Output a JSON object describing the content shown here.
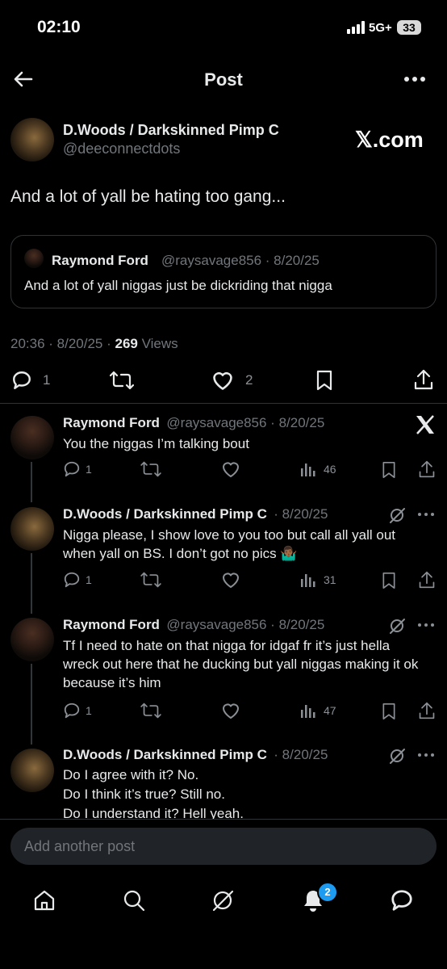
{
  "status_bar": {
    "time": "02:10",
    "network": "5G+",
    "battery": "33"
  },
  "header": {
    "title": "Post"
  },
  "main_post": {
    "author_name": "D.Woods / Darkskinned Pimp C",
    "handle": "@deeconnectdots",
    "site_badge": "𝕏.com",
    "text": "And a lot of yall be hating too gang...",
    "quote": {
      "author_name": "Raymond Ford",
      "handle_date": "@raysavage856 · 8/20/25",
      "text": "And a lot of yall niggas just be dickriding that nigga"
    },
    "timestamp": "20:36 · 8/20/25 · ",
    "views_count": "269",
    "views_label": " Views",
    "replies": "1",
    "likes": "2"
  },
  "replies": [
    {
      "author_name": "Raymond Ford",
      "meta": "@raysavage856 · 8/20/25",
      "text": "You the niggas I’m talking bout",
      "replies": "1",
      "views": "46"
    },
    {
      "author_name": "D.Woods / Darkskinned Pimp C",
      "meta": "· 8/20/25",
      "text": "Nigga please, I show love to you too but call all yall out when yall on BS. I don’t got no pics 🤷🏾‍♂️",
      "replies": "1",
      "views": "31"
    },
    {
      "author_name": "Raymond Ford",
      "meta": "@raysavage856 · 8/20/25",
      "text": "Tf I need to hate on that nigga for idgaf fr it’s just hella wreck out here that he ducking but yall niggas making it ok because it’s him",
      "replies": "1",
      "views": "47"
    },
    {
      "author_name": "D.Woods / Darkskinned Pimp C",
      "meta": "· 8/20/25",
      "line1": "Do I agree with it? No.",
      "line2": "Do I think it’s true? Still no.",
      "line3": "Do I understand it? Hell yeah."
    }
  ],
  "compose": {
    "placeholder": "Add another post"
  },
  "bottom_nav": {
    "notification_count": "2"
  },
  "colors": {
    "background": "#000000",
    "text": "#e7e9ea",
    "muted": "#71767b",
    "accent": "#1d9bf0"
  }
}
